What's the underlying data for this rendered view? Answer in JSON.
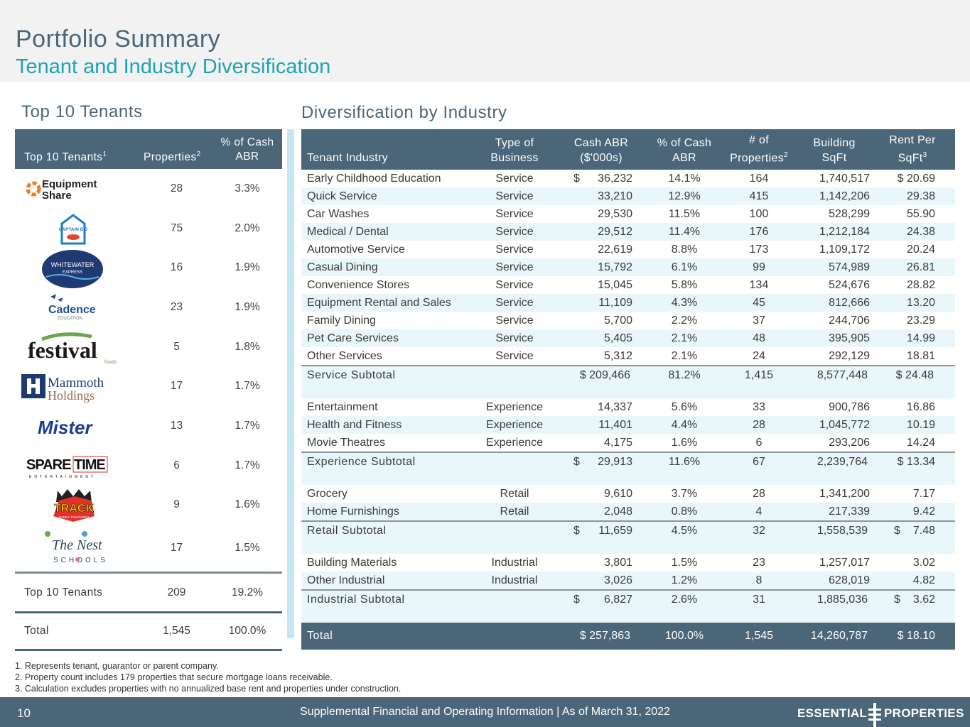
{
  "header": {
    "title": "Portfolio Summary",
    "subtitle": "Tenant and Industry Diversification"
  },
  "left_section": {
    "title": "Top 10 Tenants",
    "columns": {
      "tenant": "Top 10 Tenants",
      "tenant_sup": "1",
      "properties": "Properties",
      "properties_sup": "2",
      "abr_line1": "% of Cash",
      "abr_line2": "ABR"
    },
    "rows": [
      {
        "logo": "Equipment Share",
        "properties": "28",
        "abr": "3.3%"
      },
      {
        "logo": "Captain D's",
        "properties": "75",
        "abr": "2.0%"
      },
      {
        "logo": "Whitewater Express",
        "properties": "16",
        "abr": "1.9%"
      },
      {
        "logo": "Cadence Education",
        "properties": "23",
        "abr": "1.9%"
      },
      {
        "logo": "Festival Foods",
        "properties": "5",
        "abr": "1.8%"
      },
      {
        "logo": "Mammoth Holdings",
        "properties": "17",
        "abr": "1.7%"
      },
      {
        "logo": "Mister",
        "properties": "13",
        "abr": "1.7%"
      },
      {
        "logo": "Spare Time Entertainment",
        "properties": "6",
        "abr": "1.7%"
      },
      {
        "logo": "The Track Family Fun Parks",
        "properties": "9",
        "abr": "1.6%"
      },
      {
        "logo": "The Nest Schools",
        "properties": "17",
        "abr": "1.5%"
      }
    ],
    "logo_text": {
      "equipment_line1": "Equipment",
      "equipment_line2": "Share",
      "captain": "CAPTAIN D'S",
      "whitewater_line1": "WHITEWATER",
      "whitewater_line2": "EXPRESS",
      "cadence_line1": "Cadence",
      "cadence_line2": "EDUCATION",
      "festival_line1": "festival",
      "festival_line2": "foods",
      "mammoth_line1": "Mammoth",
      "mammoth_line2": "Holdings",
      "mister": "Mister",
      "sparetime_line1": "SPARE TIME",
      "sparetime_line2": "ENTERTAINMENT",
      "track_line1": "TRACK",
      "track_line2": "FAMILY FUN PARKS",
      "nest_line1": "The Nest",
      "nest_line2": "SCHOOLS"
    },
    "top10_label": "Top 10 Tenants",
    "top10_properties": "209",
    "top10_abr": "19.2%",
    "total_label": "Total",
    "total_properties": "1,545",
    "total_abr": "100.0%"
  },
  "right_section": {
    "title": "Diversification by Industry",
    "columns": {
      "industry": "Tenant Industry",
      "type_line1": "Type of",
      "type_line2": "Business",
      "abr_line1": "Cash ABR",
      "abr_line2": "($'000s)",
      "pct_line1": "% of Cash",
      "pct_line2": "ABR",
      "props_line1": "# of",
      "props_line2": "Properties",
      "props_sup": "2",
      "sqft_line1": "Building",
      "sqft_line2": "SqFt",
      "rent_line1": "Rent Per",
      "rent_line2": "SqFt",
      "rent_sup": "3"
    },
    "service_rows": [
      {
        "industry": "Early Childhood Education",
        "type": "Service",
        "cur": "$",
        "abr": "36,232",
        "pct": "14.1%",
        "props": "164",
        "sqft": "1,740,517",
        "rent": "$ 20.69"
      },
      {
        "industry": "Quick Service",
        "type": "Service",
        "cur": "",
        "abr": "33,210",
        "pct": "12.9%",
        "props": "415",
        "sqft": "1,142,206",
        "rent": "29.38"
      },
      {
        "industry": "Car Washes",
        "type": "Service",
        "cur": "",
        "abr": "29,530",
        "pct": "11.5%",
        "props": "100",
        "sqft": "528,299",
        "rent": "55.90"
      },
      {
        "industry": "Medical / Dental",
        "type": "Service",
        "cur": "",
        "abr": "29,512",
        "pct": "11.4%",
        "props": "176",
        "sqft": "1,212,184",
        "rent": "24.38"
      },
      {
        "industry": "Automotive Service",
        "type": "Service",
        "cur": "",
        "abr": "22,619",
        "pct": "8.8%",
        "props": "173",
        "sqft": "1,109,172",
        "rent": "20.24"
      },
      {
        "industry": "Casual Dining",
        "type": "Service",
        "cur": "",
        "abr": "15,792",
        "pct": "6.1%",
        "props": "99",
        "sqft": "574,989",
        "rent": "26.81"
      },
      {
        "industry": "Convenience Stores",
        "type": "Service",
        "cur": "",
        "abr": "15,045",
        "pct": "5.8%",
        "props": "134",
        "sqft": "524,676",
        "rent": "28.82"
      },
      {
        "industry": "Equipment Rental and Sales",
        "type": "Service",
        "cur": "",
        "abr": "11,109",
        "pct": "4.3%",
        "props": "45",
        "sqft": "812,666",
        "rent": "13.20"
      },
      {
        "industry": "Family Dining",
        "type": "Service",
        "cur": "",
        "abr": "5,700",
        "pct": "2.2%",
        "props": "37",
        "sqft": "244,706",
        "rent": "23.29"
      },
      {
        "industry": "Pet Care Services",
        "type": "Service",
        "cur": "",
        "abr": "5,405",
        "pct": "2.1%",
        "props": "48",
        "sqft": "395,905",
        "rent": "14.99"
      },
      {
        "industry": "Other Services",
        "type": "Service",
        "cur": "",
        "abr": "5,312",
        "pct": "2.1%",
        "props": "24",
        "sqft": "292,129",
        "rent": "18.81"
      }
    ],
    "service_subtotal": {
      "label": "Service Subtotal",
      "abr": "$ 209,466",
      "pct": "81.2%",
      "props": "1,415",
      "sqft": "8,577,448",
      "rent": "$ 24.48"
    },
    "experience_rows": [
      {
        "industry": "Entertainment",
        "type": "Experience",
        "cur": "",
        "abr": "14,337",
        "pct": "5.6%",
        "props": "33",
        "sqft": "900,786",
        "rent": "16.86"
      },
      {
        "industry": "Health and Fitness",
        "type": "Experience",
        "cur": "",
        "abr": "11,401",
        "pct": "4.4%",
        "props": "28",
        "sqft": "1,045,772",
        "rent": "10.19"
      },
      {
        "industry": "Movie Theatres",
        "type": "Experience",
        "cur": "",
        "abr": "4,175",
        "pct": "1.6%",
        "props": "6",
        "sqft": "293,206",
        "rent": "14.24"
      }
    ],
    "experience_subtotal": {
      "label": "Experience Subtotal",
      "cur": "$",
      "abr": "29,913",
      "pct": "11.6%",
      "props": "67",
      "sqft": "2,239,764",
      "rent": "$ 13.34"
    },
    "retail_rows": [
      {
        "industry": "Grocery",
        "type": "Retail",
        "cur": "",
        "abr": "9,610",
        "pct": "3.7%",
        "props": "28",
        "sqft": "1,341,200",
        "rent": "7.17"
      },
      {
        "industry": "Home Furnishings",
        "type": "Retail",
        "cur": "",
        "abr": "2,048",
        "pct": "0.8%",
        "props": "4",
        "sqft": "217,339",
        "rent": "9.42"
      }
    ],
    "retail_subtotal": {
      "label": "Retail Subtotal",
      "cur": "$",
      "abr": "11,659",
      "pct": "4.5%",
      "props": "32",
      "sqft": "1,558,539",
      "rcur": "$",
      "rent": "7.48"
    },
    "industrial_rows": [
      {
        "industry": "Building Materials",
        "type": "Industrial",
        "cur": "",
        "abr": "3,801",
        "pct": "1.5%",
        "props": "23",
        "sqft": "1,257,017",
        "rent": "3.02"
      },
      {
        "industry": "Other Industrial",
        "type": "Industrial",
        "cur": "",
        "abr": "3,026",
        "pct": "1.2%",
        "props": "8",
        "sqft": "628,019",
        "rent": "4.82"
      }
    ],
    "industrial_subtotal": {
      "label": "Industrial Subtotal",
      "cur": "$",
      "abr": "6,827",
      "pct": "2.6%",
      "props": "31",
      "sqft": "1,885,036",
      "rcur": "$",
      "rent": "3.62"
    },
    "total": {
      "label": "Total",
      "abr": "$ 257,863",
      "pct": "100.0%",
      "props": "1,545",
      "sqft": "14,260,787",
      "rent": "$ 18.10"
    }
  },
  "footnotes": [
    "1. Represents tenant, guarantor or parent company.",
    "2. Property count includes 179 properties that secure mortgage loans receivable.",
    "3. Calculation excludes properties with no annualized base rent and properties under construction."
  ],
  "footer": {
    "page_number": "10",
    "text": "Supplemental Financial and Operating Information |  As of March 31, 2022",
    "brand_left": "ESSENTIAL",
    "brand_right": "PROPERTIES"
  },
  "colors": {
    "header_band": "#f2f2f2",
    "primary": "#4a6678",
    "accent_teal": "#1fa3b4",
    "row_alt": "#eaf7fa",
    "divider": "#c6e6f2"
  }
}
